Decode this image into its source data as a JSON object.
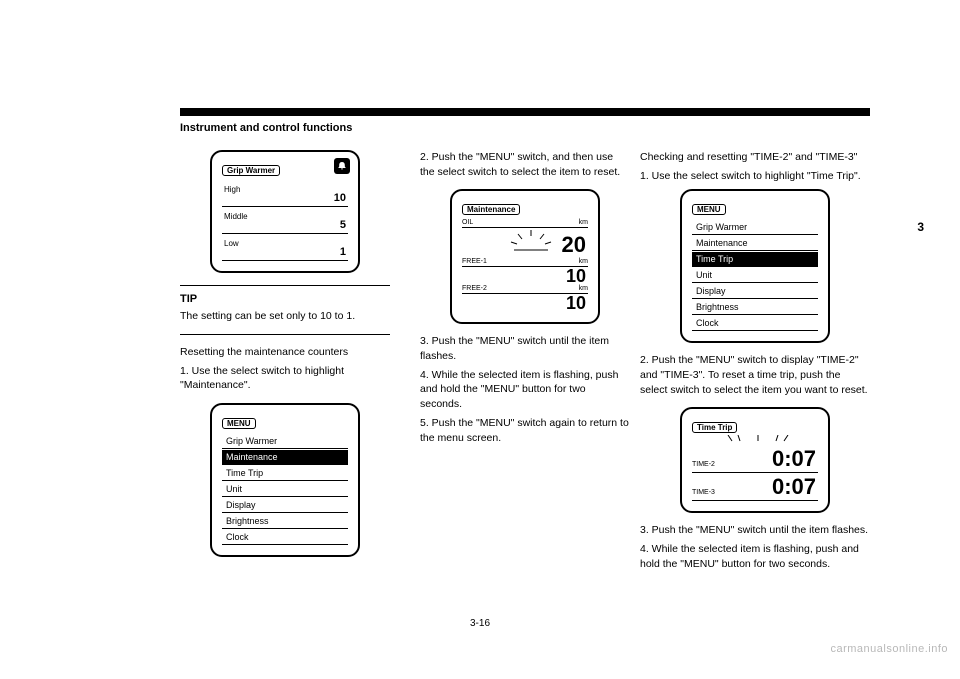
{
  "page": {
    "section_title": "Instrument and control functions",
    "margin_marker": "3",
    "footer": "3-16",
    "watermark": "carmanualsonline.info"
  },
  "col1": {
    "lcd_gripwarmer": {
      "title": "Grip Warmer",
      "rows": [
        {
          "label": "High",
          "value": "10"
        },
        {
          "label": "Middle",
          "value": "5"
        },
        {
          "label": "Low",
          "value": "1"
        }
      ]
    },
    "tip": {
      "label": "TIP",
      "text": "The setting can be set only to 10 to 1."
    },
    "para_reset": "Resetting the maintenance counters",
    "step1": "1. Use the select switch to highlight \"Maintenance\".",
    "lcd_menu_maint": {
      "title": "MENU",
      "items": [
        "Grip Warmer",
        "Maintenance",
        "Time Trip",
        "Unit",
        "Display",
        "Brightness",
        "Clock"
      ],
      "selected_index": 1
    }
  },
  "col2": {
    "step2": "2. Push the \"MENU\" switch, and then use the select switch to select the item to reset.",
    "lcd_maint": {
      "title": "Maintenance",
      "oil_label": "OIL",
      "oil_unit": "km",
      "oil_value": "20",
      "free1_label": "FREE-1",
      "free1_unit": "km",
      "free1_value": "10",
      "free2_label": "FREE-2",
      "free2_unit": "km",
      "free2_value": "10"
    },
    "step3": "3. Push the \"MENU\" switch until the item flashes.",
    "step4": "4. While the selected item is flashing, push and hold the \"MENU\" button for two seconds.",
    "step5": "5. Push the \"MENU\" switch again to return to the menu screen."
  },
  "col3": {
    "intro": "Checking and resetting \"TIME-2\" and \"TIME-3\"",
    "step1": "1. Use the select switch to highlight \"Time Trip\".",
    "lcd_menu_time": {
      "title": "MENU",
      "items": [
        "Grip Warmer",
        "Maintenance",
        "Time Trip",
        "Unit",
        "Display",
        "Brightness",
        "Clock"
      ],
      "selected_index": 2
    },
    "step2": "2. Push the \"MENU\" switch to display \"TIME-2\" and \"TIME-3\". To reset a time trip, push the select switch to select the item you want to reset.",
    "lcd_timetrip": {
      "title": "Time Trip",
      "rows": [
        {
          "label": "TIME-2",
          "value": "0:07"
        },
        {
          "label": "TIME-3",
          "value": "0:07"
        }
      ]
    },
    "step3": "3. Push the \"MENU\" switch until the item flashes.",
    "step4": "4. While the selected item is flashing, push and hold the \"MENU\" button for two seconds."
  }
}
